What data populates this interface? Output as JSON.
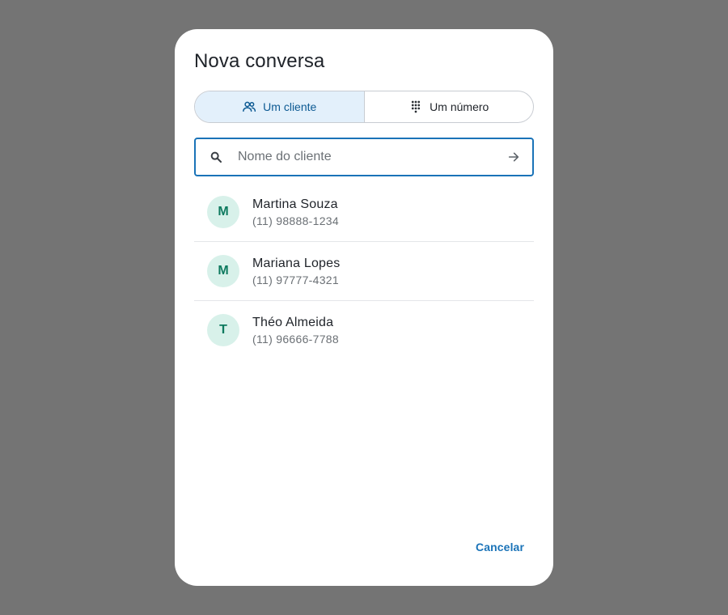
{
  "dialog": {
    "title": "Nova conversa",
    "tabs": [
      {
        "label": "Um cliente",
        "icon": "people-icon",
        "selected": true
      },
      {
        "label": "Um número",
        "icon": "dialpad-icon",
        "selected": false
      }
    ],
    "search": {
      "placeholder": "Nome do cliente",
      "value": ""
    },
    "contacts": [
      {
        "initial": "M",
        "name": "Martina Souza",
        "phone": "(11) 98888-1234"
      },
      {
        "initial": "M",
        "name": "Mariana Lopes",
        "phone": "(11) 97777-4321"
      },
      {
        "initial": "T",
        "name": "Théo Almeida",
        "phone": "(11) 96666-7788"
      }
    ],
    "cancel_label": "Cancelar"
  },
  "colors": {
    "accent": "#1a73b8",
    "selected_tab_bg": "#e3f0fb",
    "avatar_bg": "#d8f1ea",
    "avatar_fg": "#0e7a5f",
    "scrim": "#747474"
  }
}
